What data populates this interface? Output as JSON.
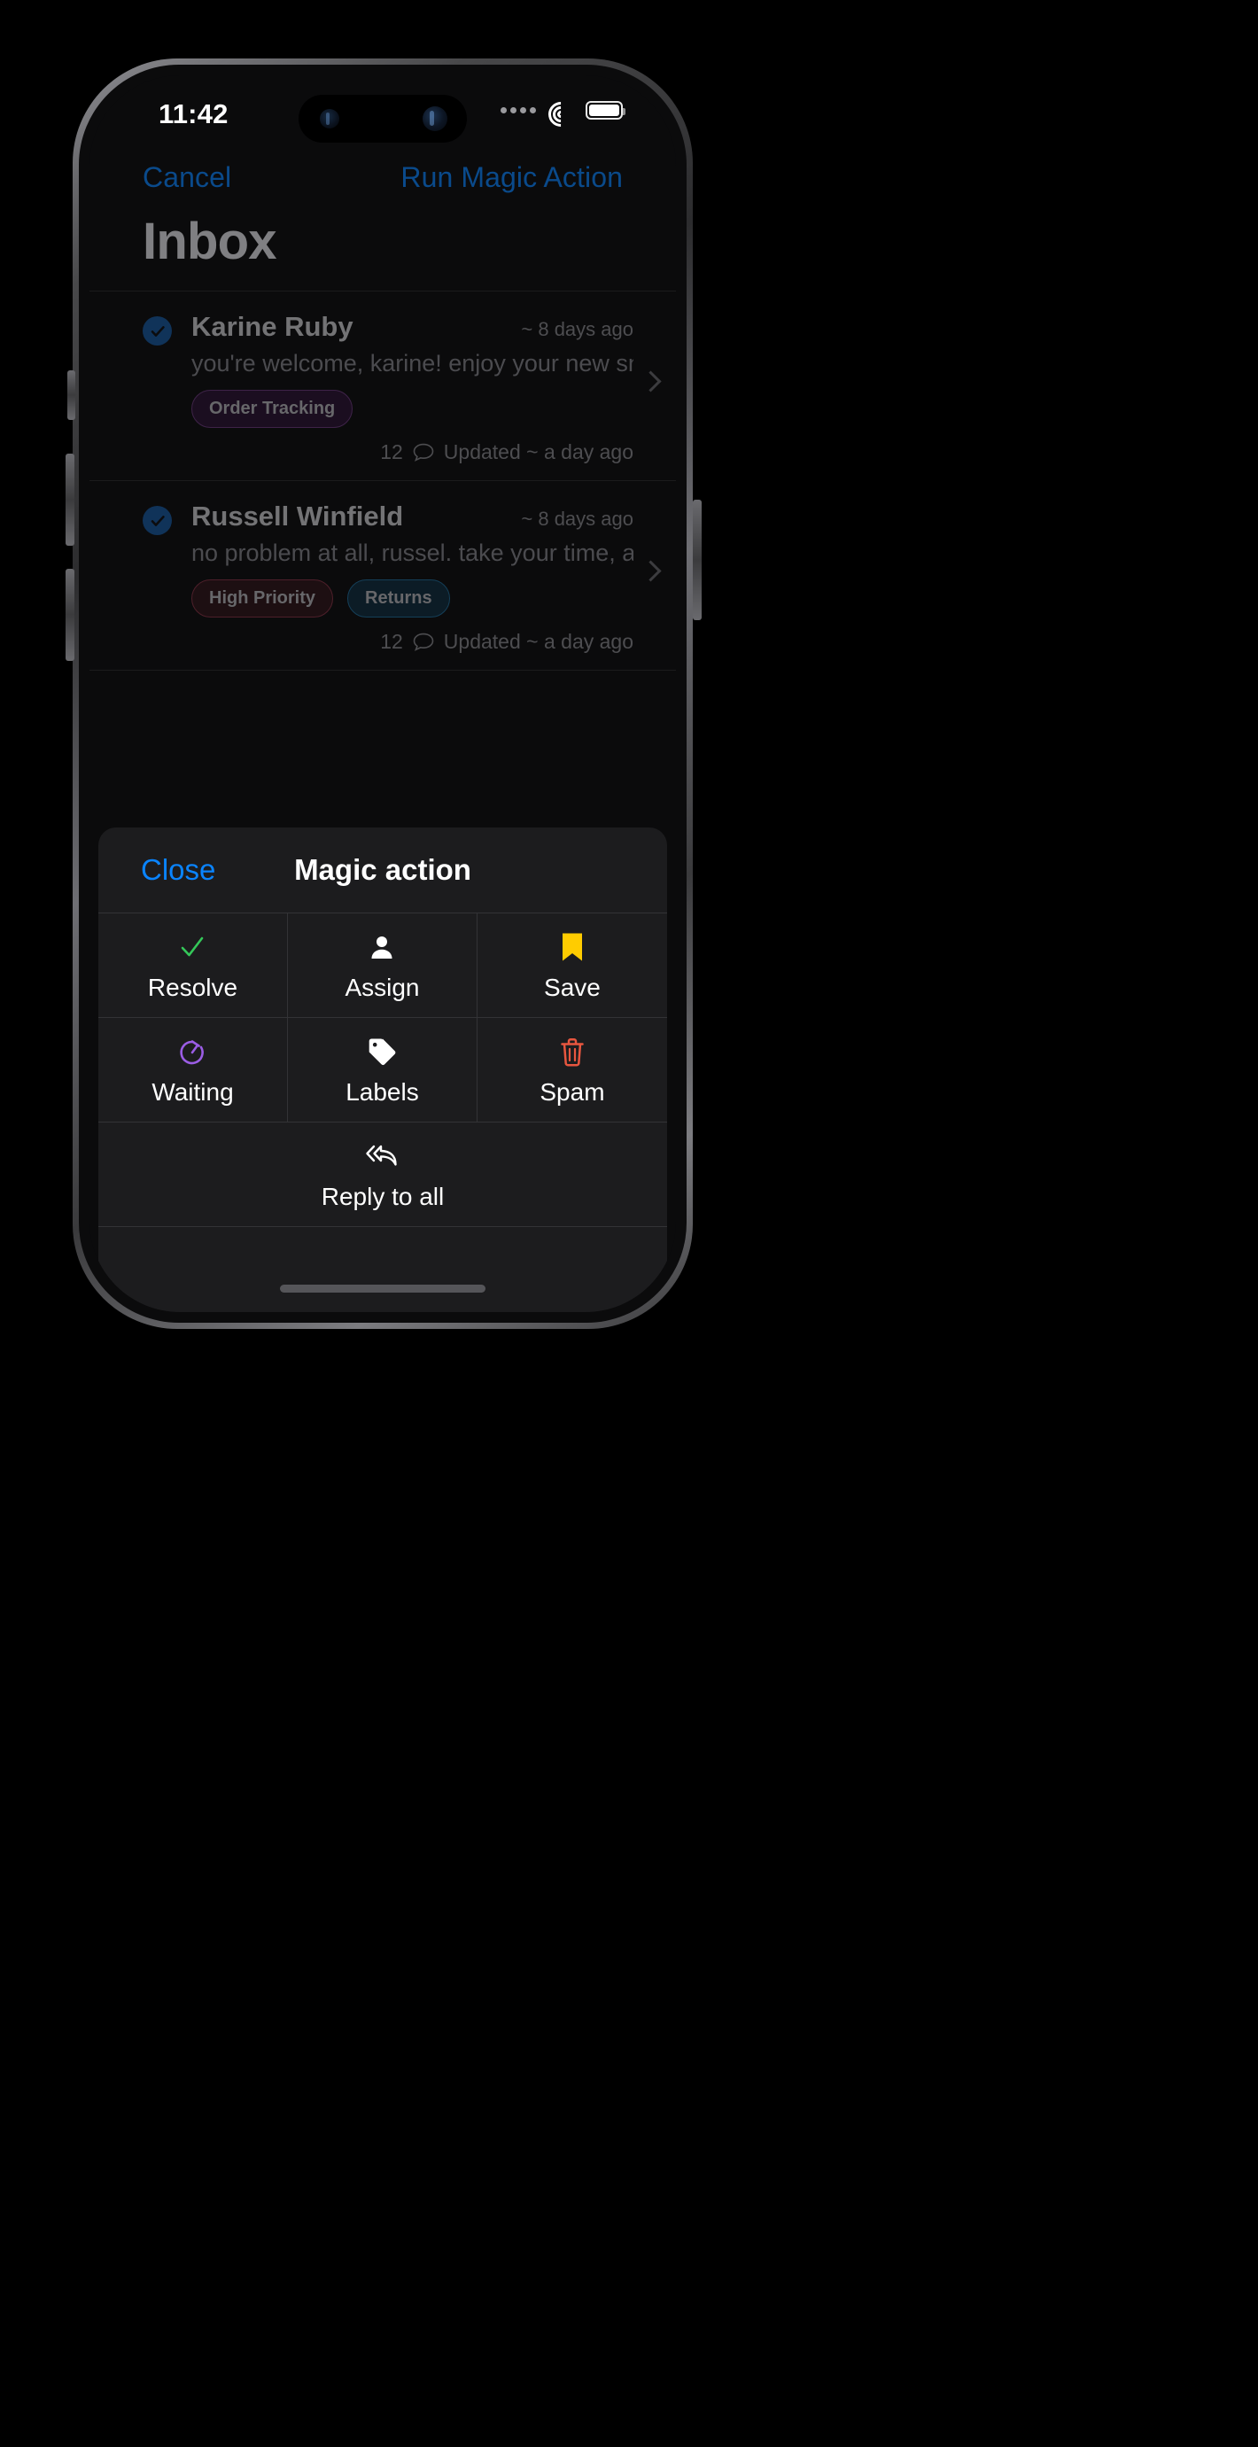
{
  "status_bar": {
    "time": "11:42",
    "cellular_icon": "cellular-dots-icon",
    "wifi_icon": "wifi-icon",
    "battery_icon": "battery-full-icon"
  },
  "nav_bar": {
    "left_button": "Cancel",
    "right_button": "Run Magic Action"
  },
  "page_title": "Inbox",
  "list": {
    "rows": [
      {
        "name": "Karine Ruby",
        "age": "~ 8 days ago",
        "snippet": "you're welcome, karine! enjoy your new sn",
        "tags": [
          {
            "label": "Order Tracking",
            "color": "purple"
          }
        ],
        "comment_count": "12",
        "updated": "Updated ~ a day ago",
        "selected": true,
        "chevron_icon": "chevron-right-icon",
        "check_icon": "check-circle-icon",
        "comment_icon": "comment-bubble-icon"
      },
      {
        "name": "Russell Winfield",
        "age": "~ 8 days ago",
        "snippet": "no problem at all, russel. take your time, a",
        "tags": [
          {
            "label": "High Priority",
            "color": "red"
          },
          {
            "label": "Returns",
            "color": "blue"
          }
        ],
        "comment_count": "12",
        "updated": "Updated ~ a day ago",
        "selected": true,
        "chevron_icon": "chevron-right-icon",
        "check_icon": "check-circle-icon",
        "comment_icon": "comment-bubble-icon"
      }
    ]
  },
  "sheet": {
    "close_label": "Close",
    "title": "Magic action",
    "actions": [
      {
        "label": "Resolve",
        "icon": "checkmark-icon",
        "color": "#34C759"
      },
      {
        "label": "Assign",
        "icon": "person-icon",
        "color": "#FFFFFF"
      },
      {
        "label": "Save",
        "icon": "bookmark-icon",
        "color": "#FFCC00"
      },
      {
        "label": "Waiting",
        "icon": "stopwatch-icon",
        "color": "#9B5DE5"
      },
      {
        "label": "Labels",
        "icon": "tag-icon",
        "color": "#FFFFFF"
      },
      {
        "label": "Spam",
        "icon": "trash-icon",
        "color": "#E8563F"
      }
    ],
    "wide_action": {
      "label": "Reply to all",
      "icon": "reply-all-icon",
      "color": "#FFFFFF"
    }
  },
  "colors": {
    "accent_blue": "#0A84FF",
    "dimmed_blue": "#1558a0",
    "sheet_bg": "#1c1c1e",
    "screen_bg": "#0b0b0c",
    "divider": "#2a2a2c"
  },
  "home_indicator": "home-indicator"
}
